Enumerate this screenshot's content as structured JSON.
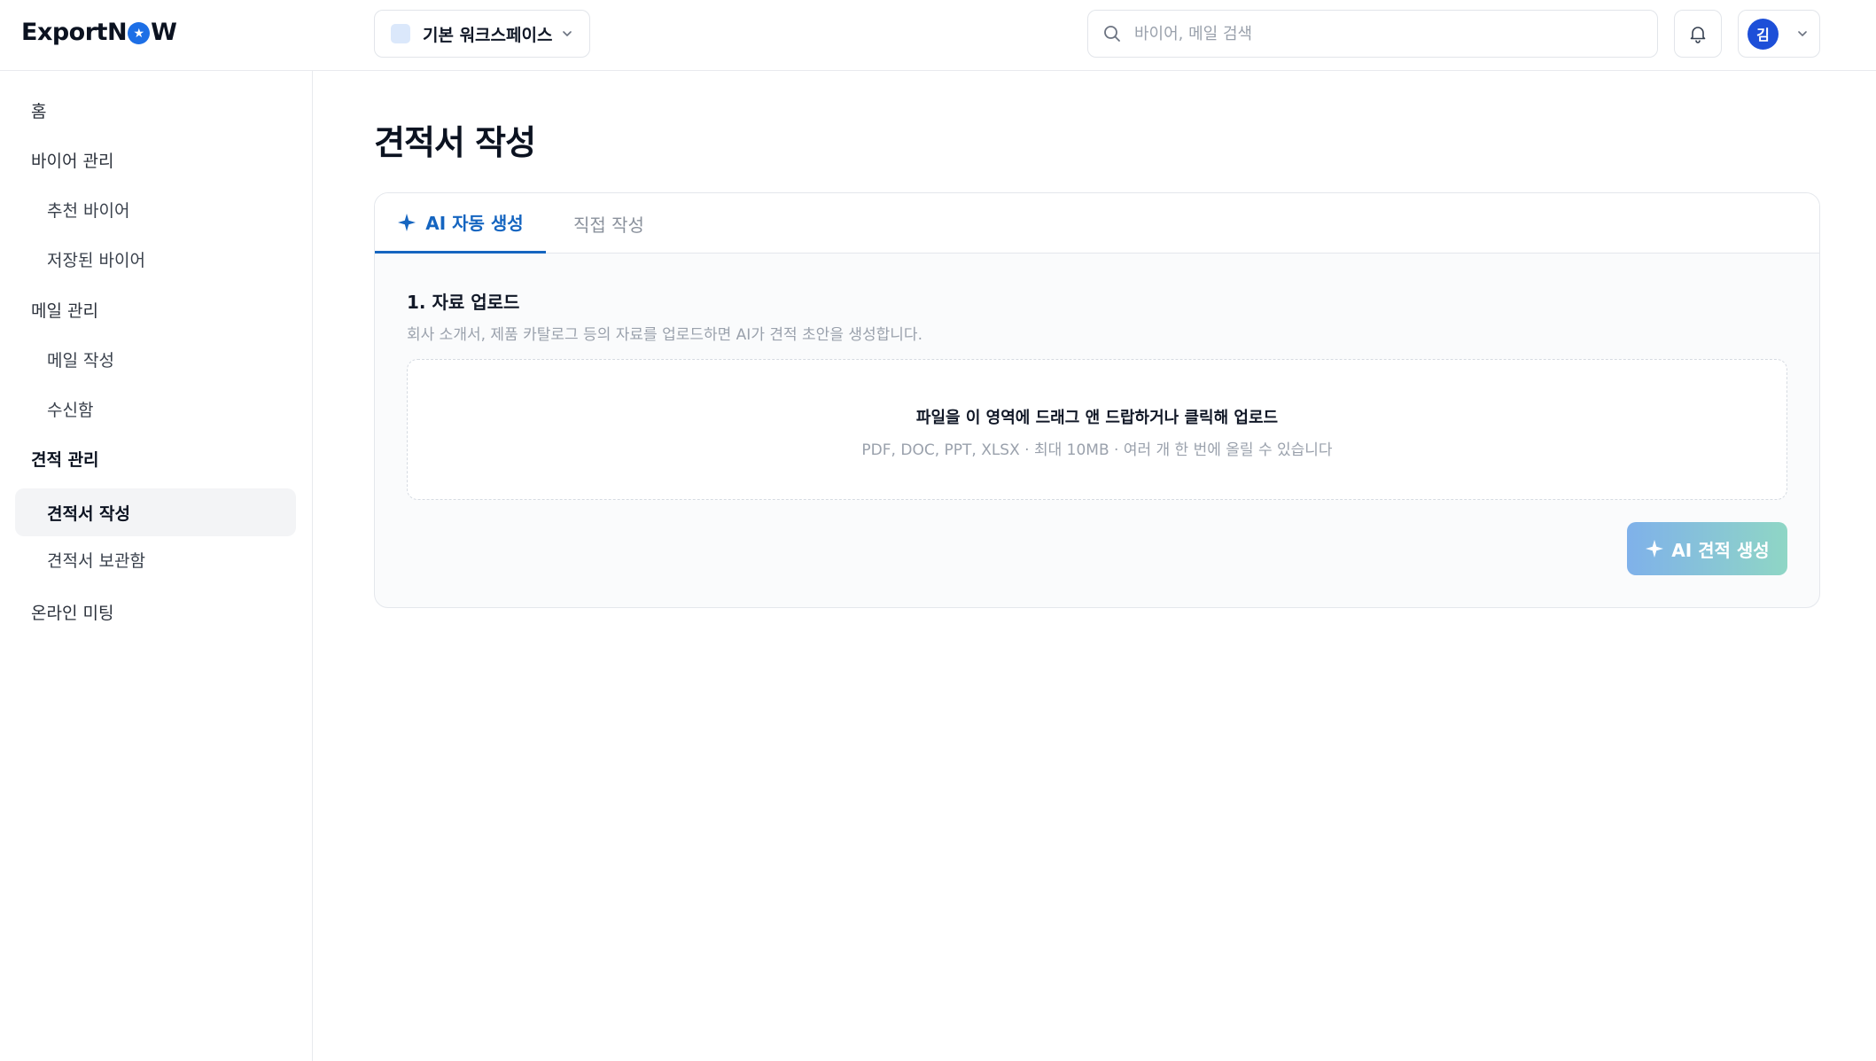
{
  "header": {
    "logo_before": "ExportN",
    "logo_after": "W",
    "workspace_label": "기본 워크스페이스",
    "search_placeholder": "바이어, 메일 검색",
    "avatar_initial": "김"
  },
  "sidebar": {
    "items": [
      {
        "label": "홈",
        "level": "top"
      },
      {
        "label": "바이어 관리",
        "level": "top"
      },
      {
        "label": "추천 바이어",
        "level": "sub"
      },
      {
        "label": "저장된 바이어",
        "level": "sub"
      },
      {
        "label": "메일 관리",
        "level": "top"
      },
      {
        "label": "메일 작성",
        "level": "sub"
      },
      {
        "label": "수신함",
        "level": "sub"
      },
      {
        "label": "견적 관리",
        "level": "top",
        "state": "section-active"
      },
      {
        "label": "견적서 작성",
        "level": "sub",
        "state": "active"
      },
      {
        "label": "견적서 보관함",
        "level": "sub"
      },
      {
        "label": "온라인 미팅",
        "level": "top"
      }
    ]
  },
  "main": {
    "title": "견적서 작성",
    "tabs": [
      {
        "label": "AI 자동 생성",
        "active": true
      },
      {
        "label": "직접 작성",
        "active": false
      }
    ],
    "upload": {
      "step_title": "1. 자료 업로드",
      "step_desc": "회사 소개서, 제품 카탈로그 등의 자료를 업로드하면 AI가 견적 초안을 생성합니다.",
      "dropzone_main": "파일을 이 영역에 드래그 앤 드랍하거나 클릭해 업로드",
      "dropzone_sub": "PDF, DOC, PPT, XLSX · 최대 10MB · 여러 개 한 번에 올릴 수 있습니다"
    },
    "generate_button": "AI 견적 생성"
  },
  "colors": {
    "accent": "#1565c0",
    "avatar": "#1d4fd8",
    "button_gradient_start": "#7fb1ea",
    "button_gradient_end": "#8fd6c5"
  }
}
